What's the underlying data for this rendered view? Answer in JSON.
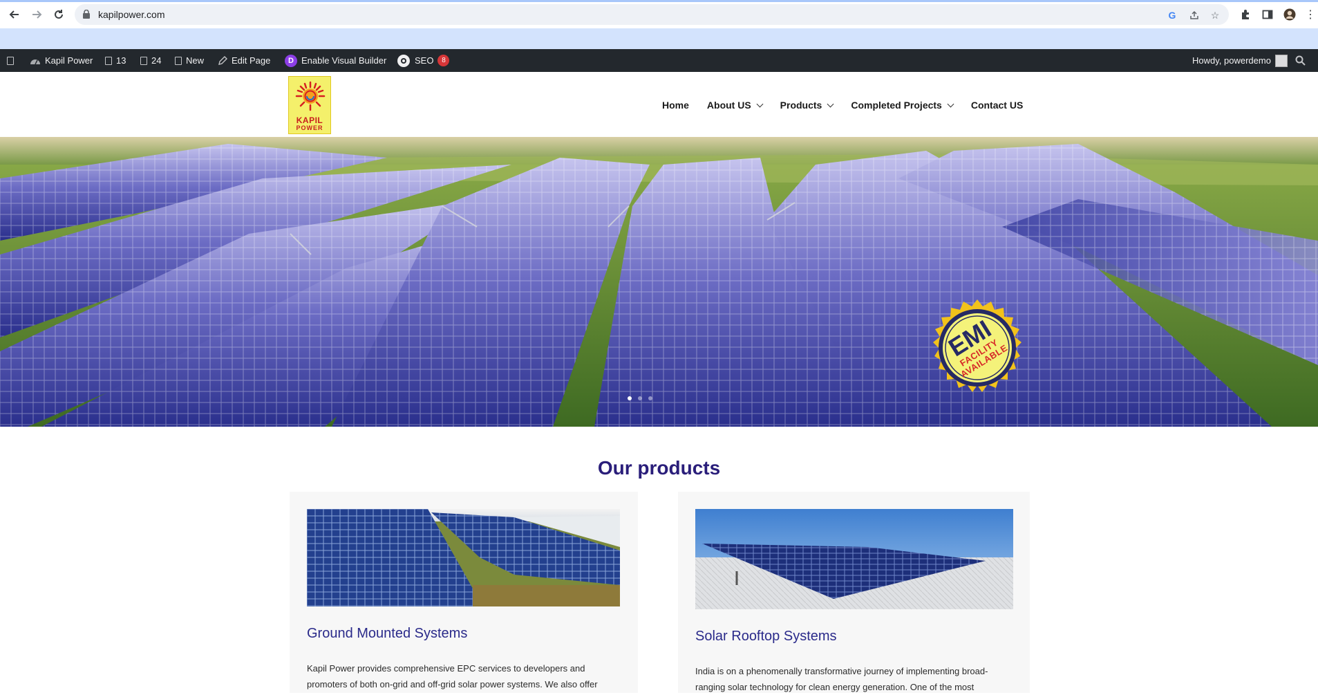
{
  "browser": {
    "url": "kapilpower.com",
    "icons": [
      "back-icon",
      "forward-icon",
      "reload-icon",
      "lock-icon",
      "google-icon",
      "share-icon",
      "star-icon",
      "extensions-icon",
      "side-panel-icon",
      "profile-icon",
      "menu-icon"
    ]
  },
  "adminbar": {
    "site_name": "Kapil Power",
    "updates_count": "13",
    "comments_count": "24",
    "new_label": "New",
    "edit_label": "Edit Page",
    "visual_builder_label": "Enable Visual Builder",
    "divi_letter": "D",
    "seo_label": "SEO",
    "seo_count": "8",
    "howdy": "Howdy, powerdemo"
  },
  "header": {
    "logo_line1": "KAPIL",
    "logo_line2": "POWER",
    "nav": [
      {
        "label": "Home",
        "has_dropdown": false
      },
      {
        "label": "About US",
        "has_dropdown": true
      },
      {
        "label": "Products",
        "has_dropdown": true
      },
      {
        "label": "Completed Projects",
        "has_dropdown": true
      },
      {
        "label": "Contact US",
        "has_dropdown": false
      }
    ]
  },
  "hero": {
    "badge_big": "EMI",
    "badge_line1": "FACILITY",
    "badge_line2": "AVAILABLE",
    "slides_count": 3,
    "active_slide": 1
  },
  "products": {
    "title_regular": "Our",
    "title_bold": "products",
    "cards": [
      {
        "title": "Ground Mounted Systems",
        "text": "Kapil Power provides comprehensive EPC services to developers and promoters of both on-grid and off-grid solar power systems. We also offer"
      },
      {
        "title": "Solar Rooftop Systems",
        "text": "India is on a phenomenally transformative journey of implementing broad-ranging solar technology for clean energy generation. One of the most"
      }
    ]
  },
  "colors": {
    "adminbar_bg": "#23282d",
    "heading_purple": "#2a1e7a",
    "card_bg": "#f7f7f7",
    "badge_yellow": "#f2ee6a"
  }
}
